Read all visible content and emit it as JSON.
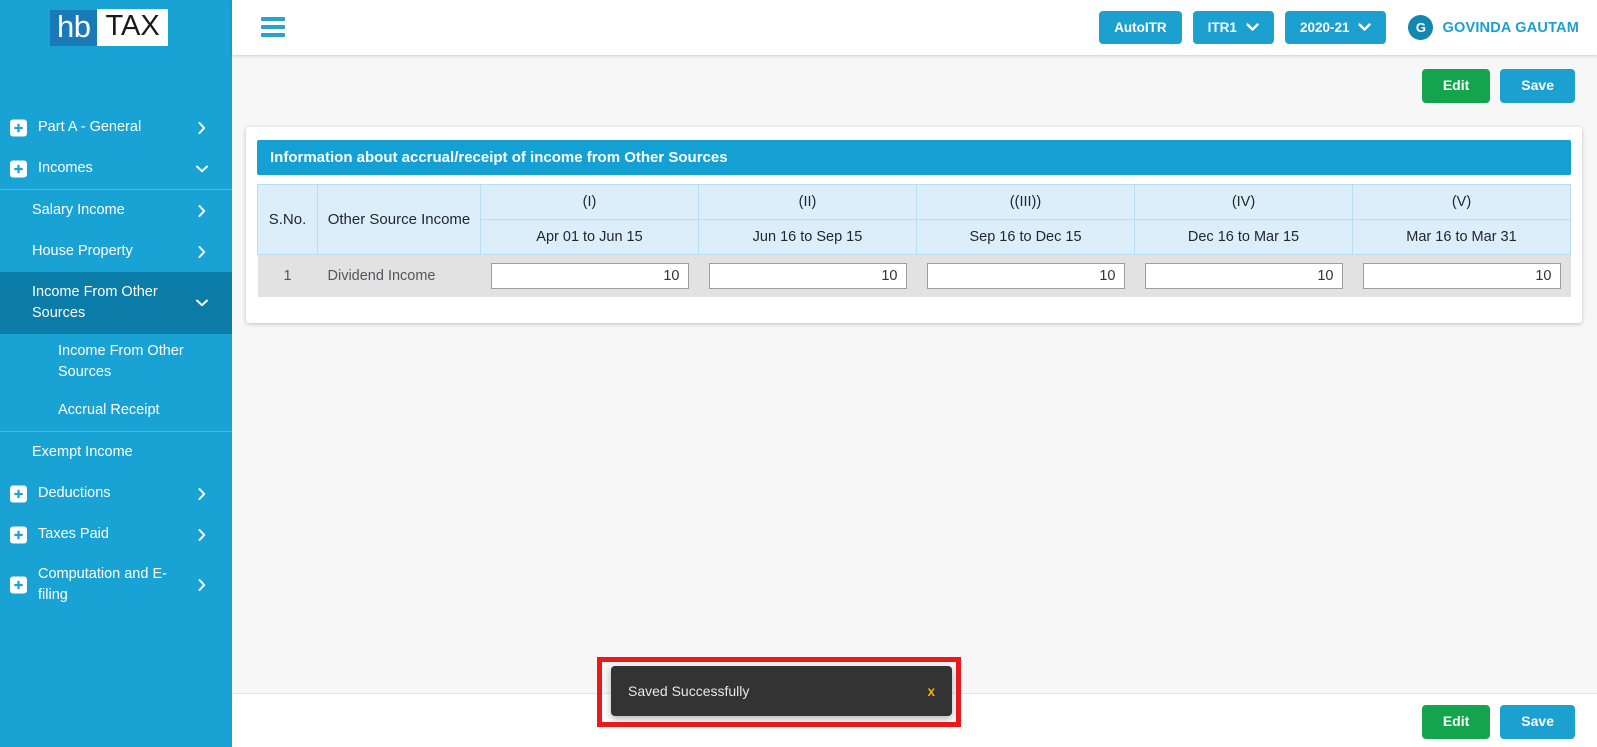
{
  "brand": {
    "logo_left": "hb",
    "logo_right": "TAX",
    "accent": "#19a3d4",
    "accent_dark": "#0b7ba7",
    "green": "#14a44d",
    "header_blue": "#1ba0d0"
  },
  "header": {
    "menu_icon": "hamburger-icon",
    "auto_itr_label": "AutoITR",
    "form_type": "ITR1",
    "assessment_year": "2020-21",
    "user_initial": "G",
    "user_name": "GOVINDA GAUTAM"
  },
  "sidebar": {
    "items": [
      {
        "label": "Part A - General",
        "level": 1,
        "icon": "plus-icon",
        "chevron": "chevron-right-icon",
        "active": false
      },
      {
        "label": "Incomes",
        "level": 1,
        "icon": "plus-icon",
        "chevron": "chevron-down-icon",
        "active": false
      },
      {
        "label": "Salary Income",
        "level": 2,
        "icon": "",
        "chevron": "chevron-right-icon",
        "active": false
      },
      {
        "label": "House Property",
        "level": 2,
        "icon": "",
        "chevron": "chevron-right-icon",
        "active": false
      },
      {
        "label": "Income From Other Sources",
        "level": 2,
        "icon": "",
        "chevron": "chevron-down-icon",
        "active": true
      },
      {
        "label": "Income From Other Sources",
        "level": 3,
        "icon": "",
        "chevron": "",
        "active": false
      },
      {
        "label": "Accrual Receipt",
        "level": 3,
        "icon": "",
        "chevron": "",
        "active": false
      },
      {
        "label": "Exempt Income",
        "level": 2,
        "icon": "",
        "chevron": "",
        "active": false
      },
      {
        "label": "Deductions",
        "level": 1,
        "icon": "plus-icon",
        "chevron": "chevron-right-icon",
        "active": false
      },
      {
        "label": "Taxes Paid",
        "level": 1,
        "icon": "plus-icon",
        "chevron": "chevron-right-icon",
        "active": false
      },
      {
        "label": "Computation and E-filing",
        "level": 1,
        "icon": "plus-icon",
        "chevron": "chevron-right-icon",
        "active": false
      }
    ]
  },
  "actions": {
    "edit_label": "Edit",
    "save_label": "Save"
  },
  "card": {
    "title": "Information about accrual/receipt of income from Other Sources",
    "columns": {
      "sno": "S.No.",
      "source": "Other Source Income",
      "roman": [
        "(I)",
        "(II)",
        "((III))",
        "(IV)",
        "(V)"
      ],
      "periods": [
        "Apr 01 to Jun 15",
        "Jun 16 to Sep 15",
        "Sep 16 to Dec 15",
        "Dec 16 to Mar 15",
        "Mar 16 to Mar 31"
      ]
    },
    "rows": [
      {
        "sno": "1",
        "source": "Dividend Income",
        "values": [
          "10",
          "10",
          "10",
          "10",
          "10"
        ]
      }
    ]
  },
  "toast": {
    "message": "Saved Successfully",
    "close_label": "x",
    "highlight_color": "#e81a1a"
  }
}
